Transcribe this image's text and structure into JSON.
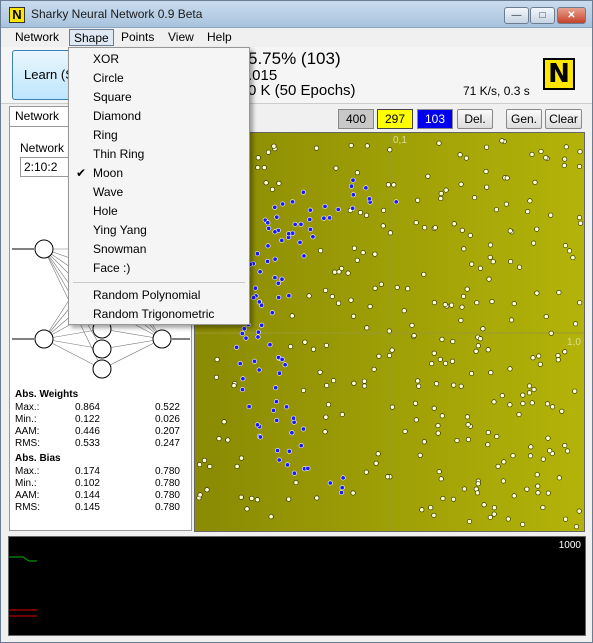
{
  "window": {
    "title": "Sharky Neural Network 0.9 Beta",
    "app_icon_letter": "N",
    "minimize_glyph": "—",
    "maximize_glyph": "□",
    "close_glyph": "✕"
  },
  "menubar": {
    "items": [
      "Network",
      "Shape",
      "Points",
      "View",
      "Help"
    ],
    "active": "Shape"
  },
  "shape_menu": {
    "items": [
      "XOR",
      "Circle",
      "Square",
      "Diamond",
      "Ring",
      "Thin Ring",
      "Moon",
      "Wave",
      "Hole",
      "Ying Yang",
      "Snowman",
      "Face :)"
    ],
    "checked": "Moon",
    "check_glyph": "✔",
    "extra_items": [
      "Random Polynomial",
      "Random Trigonometric"
    ]
  },
  "toolbar": {
    "learn_label": "Learn (S",
    "stats_line1": "5.75% (103)",
    "stats_line2": ".015",
    "stats_line3": "0 K (50 Epochs)",
    "speed": "71 K/s, 0.3 s",
    "logo_letter": "N"
  },
  "points_bar": {
    "total": "400",
    "yellow": "297",
    "blue": "103",
    "delete_label": "Del.",
    "generate_label": "Gen.",
    "clear_label": "Clear"
  },
  "network_panel": {
    "tab_label": "Network",
    "network_label": "Network",
    "network_value": "2:10:2"
  },
  "weights": {
    "heading": "Abs. Weights",
    "rows": [
      {
        "label": "Max.:",
        "v1": "0.864",
        "v2": "0.522"
      },
      {
        "label": "Min.:",
        "v1": "0.122",
        "v2": "0.026"
      },
      {
        "label": "AAM:",
        "v1": "0.446",
        "v2": "0.207"
      },
      {
        "label": "RMS:",
        "v1": "0.533",
        "v2": "0.247"
      }
    ]
  },
  "bias": {
    "heading": "Abs. Bias",
    "rows": [
      {
        "label": "Max.:",
        "v1": "0.174",
        "v2": "0.780"
      },
      {
        "label": "Min.:",
        "v1": "0.102",
        "v2": "0.780"
      },
      {
        "label": "AAM:",
        "v1": "0.144",
        "v2": "0.780"
      },
      {
        "label": "RMS:",
        "v1": "0.145",
        "v2": "0.780"
      }
    ]
  },
  "plot": {
    "axis_top_label": "0,1",
    "axis_right_label": "1,0",
    "yellow_color": "#ffffd0",
    "blue_color": "#1a1aff",
    "background_left": "#8a8a04",
    "background_right": "#b3b309"
  },
  "error_graph": {
    "max_label": "1000",
    "line_color_green": "#00b000",
    "line_color_red": "#e00000"
  }
}
